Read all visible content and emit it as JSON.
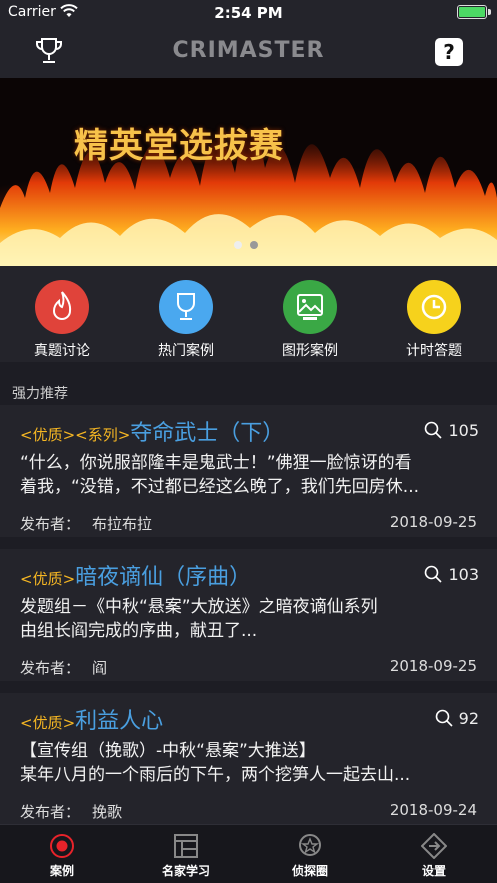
{
  "status": {
    "carrier": "Carrier",
    "time": "2:54 PM"
  },
  "nav": {
    "title": "CRIMASTER",
    "help": "?"
  },
  "banner": {
    "headline": "精英堂选拔赛"
  },
  "quick": [
    {
      "label": "真题讨论",
      "color": "#e0433a",
      "icon": "flame-icon"
    },
    {
      "label": "热门案例",
      "color": "#4aa8ef",
      "icon": "trophy-icon"
    },
    {
      "label": "图形案例",
      "color": "#3aa845",
      "icon": "image-icon"
    },
    {
      "label": "计时答题",
      "color": "#f6d21c",
      "icon": "clock-icon"
    }
  ],
  "section_title": "强力推荐",
  "author_label": "发布者：",
  "cards": [
    {
      "tags": "<优质><系列>",
      "title": "夺命武士（下）",
      "views": "105",
      "line1": "“什么，你说服部隆丰是鬼武士！”佛狸一脸惊讶的看",
      "line2": "着我，“没错，不过都已经这么晚了，我们先回房休...",
      "author": "布拉布拉",
      "date": "2018-09-25"
    },
    {
      "tags": "<优质>",
      "title": "暗夜谪仙（序曲）",
      "views": "103",
      "line1": "发题组－《中秋“悬案”大放送》之暗夜谪仙系列",
      "line2": "由组长阎完成的序曲，献丑了...",
      "author": "阎",
      "date": "2018-09-25"
    },
    {
      "tags": "<优质>",
      "title": "利益人心",
      "views": "92",
      "line1": "【宣传组（挽歌）-中秋“悬案”大推送】",
      "line2": "某年八月的一个雨后的下午，两个挖笋人一起去山...",
      "author": "挽歌",
      "date": "2018-09-24"
    }
  ],
  "tabs": [
    {
      "label": "案例",
      "icon": "record-icon",
      "active": true
    },
    {
      "label": "名家学习",
      "icon": "layout-icon",
      "active": false
    },
    {
      "label": "侦探圈",
      "icon": "badge-icon",
      "active": false
    },
    {
      "label": "设置",
      "icon": "diamond-arrow-icon",
      "active": false
    }
  ]
}
